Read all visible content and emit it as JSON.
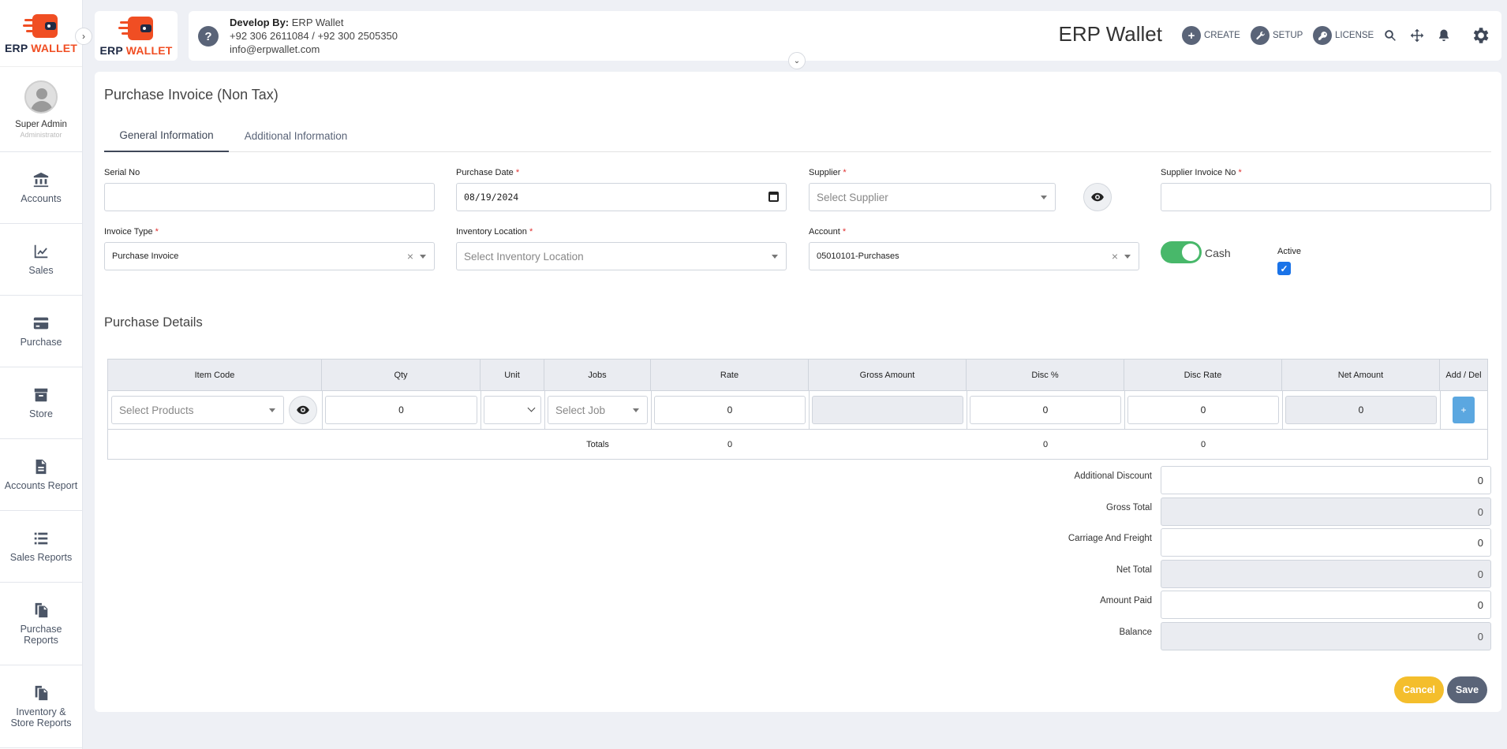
{
  "app": {
    "logo_text_1": "ERP",
    "logo_text_2": "WALLET",
    "brand_title": "ERP Wallet"
  },
  "user": {
    "name": "Super Admin",
    "role": "Administrator"
  },
  "sidebar": {
    "items": [
      {
        "label": "Accounts"
      },
      {
        "label": "Sales"
      },
      {
        "label": "Purchase"
      },
      {
        "label": "Store"
      },
      {
        "label": "Accounts Report"
      },
      {
        "label": "Sales Reports"
      },
      {
        "label": "Purchase Reports"
      },
      {
        "label": "Inventory & Store Reports"
      }
    ]
  },
  "header": {
    "develop_by_label": "Develop By:",
    "develop_by_value": "ERP Wallet",
    "phones": "+92 306 2611084 / +92 300 2505350",
    "email": "info@erpwallet.com",
    "help_glyph": "?",
    "create_label": "CREATE",
    "setup_label": "SETUP",
    "license_label": "LICENSE",
    "icons": [
      "search-icon",
      "move-icon",
      "bell-icon",
      "gear-icon"
    ]
  },
  "page": {
    "title": "Purchase Invoice (Non Tax)",
    "tabs": [
      {
        "label": "General Information"
      },
      {
        "label": "Additional Information"
      }
    ]
  },
  "form": {
    "serial_no": {
      "label": "Serial No",
      "value": ""
    },
    "purchase_date": {
      "label": "Purchase Date",
      "value": "08/19/2024"
    },
    "supplier": {
      "label": "Supplier",
      "placeholder": "Select Supplier"
    },
    "supplier_invoice_no": {
      "label": "Supplier Invoice No",
      "value": ""
    },
    "invoice_type": {
      "label": "Invoice Type",
      "value": "Purchase Invoice"
    },
    "inventory_location": {
      "label": "Inventory Location",
      "placeholder": "Select Inventory Location"
    },
    "account": {
      "label": "Account",
      "value": "05010101-Purchases"
    },
    "cash_label": "Cash",
    "active_label": "Active",
    "required_mark": "*"
  },
  "details": {
    "title": "Purchase Details",
    "columns": [
      "Item Code",
      "Qty",
      "Unit",
      "Jobs",
      "Rate",
      "Gross Amount",
      "Disc %",
      "Disc Rate",
      "Net Amount",
      "Add / Del"
    ],
    "row": {
      "product_placeholder": "Select Products",
      "qty": "0",
      "unit": "",
      "job_placeholder": "Select Job",
      "rate": "0",
      "gross_amount": "",
      "disc_pct": "0",
      "disc_rate": "0",
      "net_amount": "0",
      "add_label": "+"
    },
    "totals": {
      "label": "Totals",
      "rate": "0",
      "disc_pct": "0",
      "disc_rate": "0"
    }
  },
  "summary": [
    {
      "label": "Additional Discount",
      "value": "0",
      "readonly": false
    },
    {
      "label": "Gross Total",
      "value": "0",
      "readonly": true
    },
    {
      "label": "Carriage And Freight",
      "value": "0",
      "readonly": false
    },
    {
      "label": "Net Total",
      "value": "0",
      "readonly": true
    },
    {
      "label": "Amount Paid",
      "value": "0",
      "readonly": false
    },
    {
      "label": "Balance",
      "value": "0",
      "readonly": true
    }
  ],
  "actions": {
    "cancel_label": "Cancel",
    "save_label": "Save"
  },
  "colors": {
    "accent": "#5a6478",
    "brand_orange": "#f04e23",
    "toggle_on": "#48b86a",
    "cancel": "#f4be2c",
    "add_button": "#5ba7e0",
    "checkbox": "#1a73e8"
  }
}
